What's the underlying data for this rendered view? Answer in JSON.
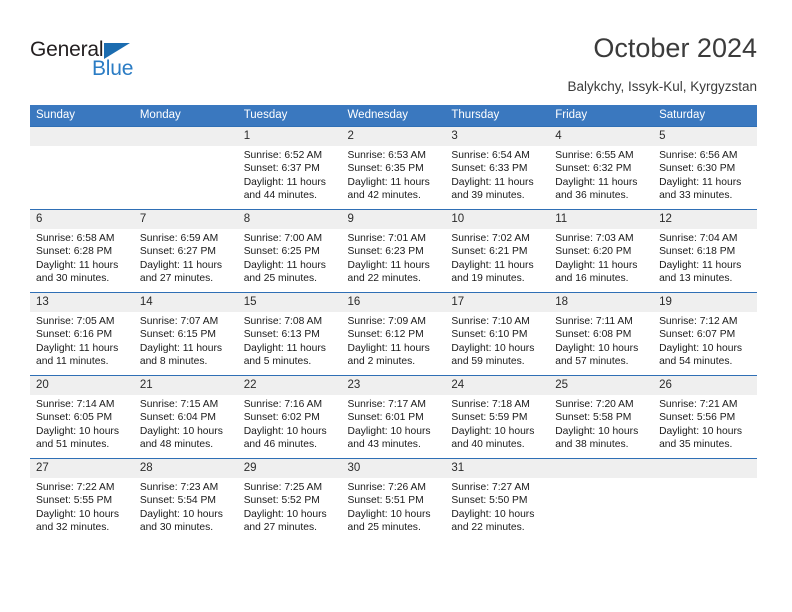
{
  "brand": {
    "name_top": "General",
    "name_bottom": "Blue",
    "triangle_color": "#1b6cb0",
    "blue_text_color": "#2b7cc4"
  },
  "header": {
    "title": "October 2024",
    "subtitle": "Balykchy, Issyk-Kul, Kyrgyzstan",
    "header_bg": "#3a78bf",
    "row_border_color": "#2f6fb5",
    "daynum_bg": "#efefef"
  },
  "weekday_headers": [
    "Sunday",
    "Monday",
    "Tuesday",
    "Wednesday",
    "Thursday",
    "Friday",
    "Saturday"
  ],
  "labels": {
    "sunrise_prefix": "Sunrise:",
    "sunset_prefix": "Sunset:",
    "daylight_prefix": "Daylight:"
  },
  "weeks": [
    [
      {
        "day": "",
        "sunrise": "",
        "sunset": "",
        "daylight": "",
        "empty": true
      },
      {
        "day": "",
        "sunrise": "",
        "sunset": "",
        "daylight": "",
        "empty": true
      },
      {
        "day": "1",
        "sunrise": "Sunrise: 6:52 AM",
        "sunset": "Sunset: 6:37 PM",
        "daylight": "Daylight: 11 hours and 44 minutes."
      },
      {
        "day": "2",
        "sunrise": "Sunrise: 6:53 AM",
        "sunset": "Sunset: 6:35 PM",
        "daylight": "Daylight: 11 hours and 42 minutes."
      },
      {
        "day": "3",
        "sunrise": "Sunrise: 6:54 AM",
        "sunset": "Sunset: 6:33 PM",
        "daylight": "Daylight: 11 hours and 39 minutes."
      },
      {
        "day": "4",
        "sunrise": "Sunrise: 6:55 AM",
        "sunset": "Sunset: 6:32 PM",
        "daylight": "Daylight: 11 hours and 36 minutes."
      },
      {
        "day": "5",
        "sunrise": "Sunrise: 6:56 AM",
        "sunset": "Sunset: 6:30 PM",
        "daylight": "Daylight: 11 hours and 33 minutes."
      }
    ],
    [
      {
        "day": "6",
        "sunrise": "Sunrise: 6:58 AM",
        "sunset": "Sunset: 6:28 PM",
        "daylight": "Daylight: 11 hours and 30 minutes."
      },
      {
        "day": "7",
        "sunrise": "Sunrise: 6:59 AM",
        "sunset": "Sunset: 6:27 PM",
        "daylight": "Daylight: 11 hours and 27 minutes."
      },
      {
        "day": "8",
        "sunrise": "Sunrise: 7:00 AM",
        "sunset": "Sunset: 6:25 PM",
        "daylight": "Daylight: 11 hours and 25 minutes."
      },
      {
        "day": "9",
        "sunrise": "Sunrise: 7:01 AM",
        "sunset": "Sunset: 6:23 PM",
        "daylight": "Daylight: 11 hours and 22 minutes."
      },
      {
        "day": "10",
        "sunrise": "Sunrise: 7:02 AM",
        "sunset": "Sunset: 6:21 PM",
        "daylight": "Daylight: 11 hours and 19 minutes."
      },
      {
        "day": "11",
        "sunrise": "Sunrise: 7:03 AM",
        "sunset": "Sunset: 6:20 PM",
        "daylight": "Daylight: 11 hours and 16 minutes."
      },
      {
        "day": "12",
        "sunrise": "Sunrise: 7:04 AM",
        "sunset": "Sunset: 6:18 PM",
        "daylight": "Daylight: 11 hours and 13 minutes."
      }
    ],
    [
      {
        "day": "13",
        "sunrise": "Sunrise: 7:05 AM",
        "sunset": "Sunset: 6:16 PM",
        "daylight": "Daylight: 11 hours and 11 minutes."
      },
      {
        "day": "14",
        "sunrise": "Sunrise: 7:07 AM",
        "sunset": "Sunset: 6:15 PM",
        "daylight": "Daylight: 11 hours and 8 minutes."
      },
      {
        "day": "15",
        "sunrise": "Sunrise: 7:08 AM",
        "sunset": "Sunset: 6:13 PM",
        "daylight": "Daylight: 11 hours and 5 minutes."
      },
      {
        "day": "16",
        "sunrise": "Sunrise: 7:09 AM",
        "sunset": "Sunset: 6:12 PM",
        "daylight": "Daylight: 11 hours and 2 minutes."
      },
      {
        "day": "17",
        "sunrise": "Sunrise: 7:10 AM",
        "sunset": "Sunset: 6:10 PM",
        "daylight": "Daylight: 10 hours and 59 minutes."
      },
      {
        "day": "18",
        "sunrise": "Sunrise: 7:11 AM",
        "sunset": "Sunset: 6:08 PM",
        "daylight": "Daylight: 10 hours and 57 minutes."
      },
      {
        "day": "19",
        "sunrise": "Sunrise: 7:12 AM",
        "sunset": "Sunset: 6:07 PM",
        "daylight": "Daylight: 10 hours and 54 minutes."
      }
    ],
    [
      {
        "day": "20",
        "sunrise": "Sunrise: 7:14 AM",
        "sunset": "Sunset: 6:05 PM",
        "daylight": "Daylight: 10 hours and 51 minutes."
      },
      {
        "day": "21",
        "sunrise": "Sunrise: 7:15 AM",
        "sunset": "Sunset: 6:04 PM",
        "daylight": "Daylight: 10 hours and 48 minutes."
      },
      {
        "day": "22",
        "sunrise": "Sunrise: 7:16 AM",
        "sunset": "Sunset: 6:02 PM",
        "daylight": "Daylight: 10 hours and 46 minutes."
      },
      {
        "day": "23",
        "sunrise": "Sunrise: 7:17 AM",
        "sunset": "Sunset: 6:01 PM",
        "daylight": "Daylight: 10 hours and 43 minutes."
      },
      {
        "day": "24",
        "sunrise": "Sunrise: 7:18 AM",
        "sunset": "Sunset: 5:59 PM",
        "daylight": "Daylight: 10 hours and 40 minutes."
      },
      {
        "day": "25",
        "sunrise": "Sunrise: 7:20 AM",
        "sunset": "Sunset: 5:58 PM",
        "daylight": "Daylight: 10 hours and 38 minutes."
      },
      {
        "day": "26",
        "sunrise": "Sunrise: 7:21 AM",
        "sunset": "Sunset: 5:56 PM",
        "daylight": "Daylight: 10 hours and 35 minutes."
      }
    ],
    [
      {
        "day": "27",
        "sunrise": "Sunrise: 7:22 AM",
        "sunset": "Sunset: 5:55 PM",
        "daylight": "Daylight: 10 hours and 32 minutes."
      },
      {
        "day": "28",
        "sunrise": "Sunrise: 7:23 AM",
        "sunset": "Sunset: 5:54 PM",
        "daylight": "Daylight: 10 hours and 30 minutes."
      },
      {
        "day": "29",
        "sunrise": "Sunrise: 7:25 AM",
        "sunset": "Sunset: 5:52 PM",
        "daylight": "Daylight: 10 hours and 27 minutes."
      },
      {
        "day": "30",
        "sunrise": "Sunrise: 7:26 AM",
        "sunset": "Sunset: 5:51 PM",
        "daylight": "Daylight: 10 hours and 25 minutes."
      },
      {
        "day": "31",
        "sunrise": "Sunrise: 7:27 AM",
        "sunset": "Sunset: 5:50 PM",
        "daylight": "Daylight: 10 hours and 22 minutes."
      },
      {
        "day": "",
        "sunrise": "",
        "sunset": "",
        "daylight": "",
        "empty": true
      },
      {
        "day": "",
        "sunrise": "",
        "sunset": "",
        "daylight": "",
        "empty": true
      }
    ]
  ]
}
